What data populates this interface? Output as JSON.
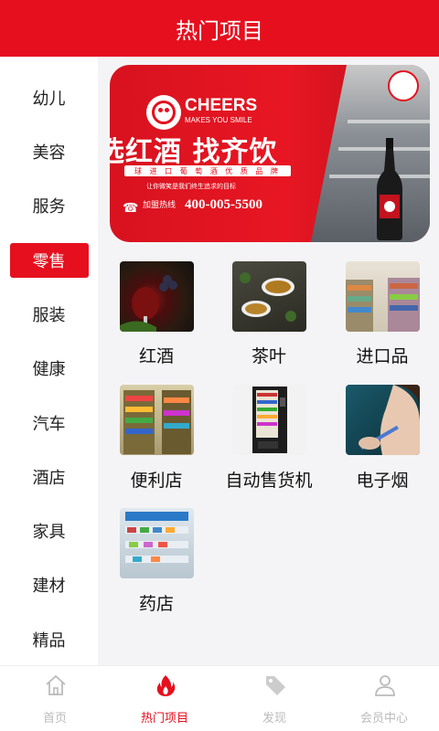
{
  "header": {
    "title": "热门项目"
  },
  "sidebar": {
    "items": [
      {
        "label": "幼儿"
      },
      {
        "label": "美容"
      },
      {
        "label": "服务"
      },
      {
        "label": "零售",
        "active": true
      },
      {
        "label": "服装"
      },
      {
        "label": "健康"
      },
      {
        "label": "汽车"
      },
      {
        "label": "酒店"
      },
      {
        "label": "家具"
      },
      {
        "label": "建材"
      },
      {
        "label": "精品"
      }
    ]
  },
  "banner": {
    "brand": "CHEERS",
    "brand_sub": "MAKES YOU SMILE",
    "slogan": "选红酒 找齐饮",
    "slogan_bar": "球 进 口 葡 萄 酒 优 质 品 牌",
    "slogan_sub": "让你微笑是我们终生追求的目标",
    "hotline_label": "加盟热线",
    "hotline_number": "400-005-5500"
  },
  "grid": {
    "items": [
      {
        "label": "红酒",
        "icon": "red-wine"
      },
      {
        "label": "茶叶",
        "icon": "tea"
      },
      {
        "label": "进口品",
        "icon": "import-store"
      },
      {
        "label": "便利店",
        "icon": "convenience-store"
      },
      {
        "label": "自动售货机",
        "icon": "vending-machine"
      },
      {
        "label": "电子烟",
        "icon": "e-cigarette"
      },
      {
        "label": "药店",
        "icon": "pharmacy"
      }
    ]
  },
  "tabbar": {
    "tabs": [
      {
        "label": "首页",
        "icon": "home-icon"
      },
      {
        "label": "热门项目",
        "icon": "flame-icon",
        "active": true
      },
      {
        "label": "发现",
        "icon": "tag-icon"
      },
      {
        "label": "会员中心",
        "icon": "user-icon"
      }
    ]
  },
  "colors": {
    "accent": "#e60f1e",
    "background": "#f4f4f6",
    "tab_inactive": "#bbbbbb"
  }
}
